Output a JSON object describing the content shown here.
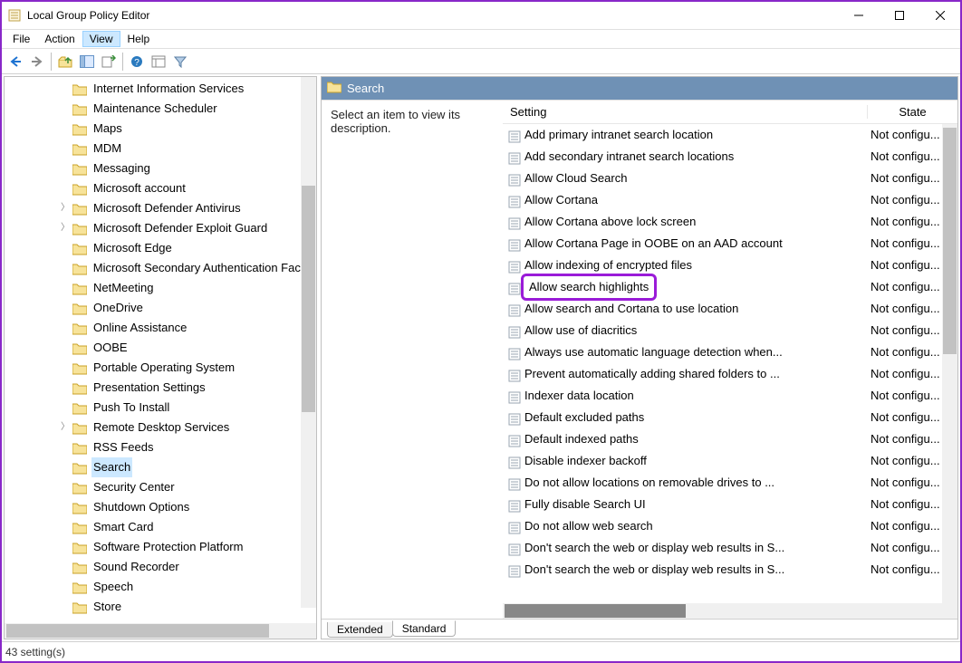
{
  "window": {
    "title": "Local Group Policy Editor"
  },
  "menubar": {
    "items": [
      "File",
      "Action",
      "View",
      "Help"
    ],
    "highlighted_index": 2
  },
  "tree": {
    "items": [
      {
        "label": "Internet Information Services",
        "indent": 3,
        "expandable": false
      },
      {
        "label": "Maintenance Scheduler",
        "indent": 3,
        "expandable": false
      },
      {
        "label": "Maps",
        "indent": 3,
        "expandable": false
      },
      {
        "label": "MDM",
        "indent": 3,
        "expandable": false
      },
      {
        "label": "Messaging",
        "indent": 3,
        "expandable": false
      },
      {
        "label": "Microsoft account",
        "indent": 3,
        "expandable": false
      },
      {
        "label": "Microsoft Defender Antivirus",
        "indent": 3,
        "expandable": true
      },
      {
        "label": "Microsoft Defender Exploit Guard",
        "indent": 3,
        "expandable": true
      },
      {
        "label": "Microsoft Edge",
        "indent": 3,
        "expandable": false
      },
      {
        "label": "Microsoft Secondary Authentication Factor",
        "indent": 3,
        "expandable": false
      },
      {
        "label": "NetMeeting",
        "indent": 3,
        "expandable": false
      },
      {
        "label": "OneDrive",
        "indent": 3,
        "expandable": false
      },
      {
        "label": "Online Assistance",
        "indent": 3,
        "expandable": false
      },
      {
        "label": "OOBE",
        "indent": 3,
        "expandable": false
      },
      {
        "label": "Portable Operating System",
        "indent": 3,
        "expandable": false
      },
      {
        "label": "Presentation Settings",
        "indent": 3,
        "expandable": false
      },
      {
        "label": "Push To Install",
        "indent": 3,
        "expandable": false
      },
      {
        "label": "Remote Desktop Services",
        "indent": 3,
        "expandable": true
      },
      {
        "label": "RSS Feeds",
        "indent": 3,
        "expandable": false
      },
      {
        "label": "Search",
        "indent": 3,
        "expandable": false,
        "selected": true
      },
      {
        "label": "Security Center",
        "indent": 3,
        "expandable": false
      },
      {
        "label": "Shutdown Options",
        "indent": 3,
        "expandable": false
      },
      {
        "label": "Smart Card",
        "indent": 3,
        "expandable": false
      },
      {
        "label": "Software Protection Platform",
        "indent": 3,
        "expandable": false
      },
      {
        "label": "Sound Recorder",
        "indent": 3,
        "expandable": false
      },
      {
        "label": "Speech",
        "indent": 3,
        "expandable": false
      },
      {
        "label": "Store",
        "indent": 3,
        "expandable": false
      }
    ]
  },
  "right": {
    "title": "Search",
    "description": "Select an item to view its description.",
    "columns": {
      "setting": "Setting",
      "state": "State"
    },
    "settings": [
      {
        "name": "Add primary intranet search location",
        "state": "Not configu..."
      },
      {
        "name": "Add secondary intranet search locations",
        "state": "Not configu..."
      },
      {
        "name": "Allow Cloud Search",
        "state": "Not configu..."
      },
      {
        "name": "Allow Cortana",
        "state": "Not configu..."
      },
      {
        "name": "Allow Cortana above lock screen",
        "state": "Not configu..."
      },
      {
        "name": "Allow Cortana Page in OOBE on an AAD account",
        "state": "Not configu..."
      },
      {
        "name": "Allow indexing of encrypted files",
        "state": "Not configu..."
      },
      {
        "name": "Allow search highlights",
        "state": "Not configu...",
        "highlighted": true
      },
      {
        "name": "Allow search and Cortana to use location",
        "state": "Not configu..."
      },
      {
        "name": "Allow use of diacritics",
        "state": "Not configu..."
      },
      {
        "name": "Always use automatic language detection when...",
        "state": "Not configu..."
      },
      {
        "name": "Prevent automatically adding shared folders to ...",
        "state": "Not configu..."
      },
      {
        "name": "Indexer data location",
        "state": "Not configu..."
      },
      {
        "name": "Default excluded paths",
        "state": "Not configu..."
      },
      {
        "name": "Default indexed paths",
        "state": "Not configu..."
      },
      {
        "name": "Disable indexer backoff",
        "state": "Not configu..."
      },
      {
        "name": "Do not allow locations on removable drives to ...",
        "state": "Not configu..."
      },
      {
        "name": "Fully disable Search UI",
        "state": "Not configu..."
      },
      {
        "name": "Do not allow web search",
        "state": "Not configu..."
      },
      {
        "name": "Don't search the web or display web results in S...",
        "state": "Not configu..."
      },
      {
        "name": "Don't search the web or display web results in S...",
        "state": "Not configu..."
      }
    ],
    "tabs": {
      "extended": "Extended",
      "standard": "Standard",
      "active": "standard"
    }
  },
  "statusbar": {
    "text": "43 setting(s)"
  }
}
